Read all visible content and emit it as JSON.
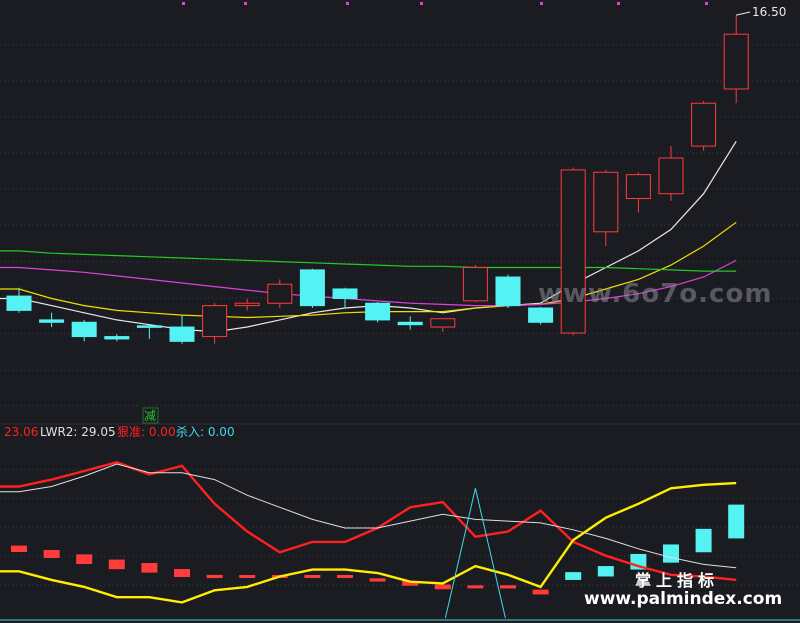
{
  "colors": {
    "background": "#1b1c21",
    "grid": "#3a3b46",
    "up": "#ff3b3b",
    "down": "#54f2f2",
    "ma_white": "#e8e8e8",
    "ma_yellow": "#f0e000",
    "ma_magenta": "#e040e0",
    "ma_green": "#22cc22",
    "ind_red": "#ff2020",
    "ind_yellow": "#ffee00",
    "ind_white": "#e0e0e0",
    "ind_cyan": "#3fd8e8"
  },
  "chart_data": [
    {
      "type": "candlestick",
      "ylim": [
        0,
        16.8
      ],
      "max_label": "16.50",
      "marker_text": "减",
      "candles": [
        {
          "o": 4.7,
          "h": 5.05,
          "l": 4.0,
          "c": 4.1
        },
        {
          "o": 3.7,
          "h": 4.0,
          "l": 3.4,
          "c": 3.6
        },
        {
          "o": 3.6,
          "h": 3.7,
          "l": 2.8,
          "c": 3.0
        },
        {
          "o": 3.0,
          "h": 3.1,
          "l": 2.8,
          "c": 2.9
        },
        {
          "o": 3.45,
          "h": 3.5,
          "l": 2.9,
          "c": 3.4
        },
        {
          "o": 3.4,
          "h": 3.9,
          "l": 2.7,
          "c": 2.8
        },
        {
          "o": 3.0,
          "h": 4.4,
          "l": 2.7,
          "c": 4.3
        },
        {
          "o": 4.3,
          "h": 4.6,
          "l": 4.1,
          "c": 4.4
        },
        {
          "o": 4.4,
          "h": 5.4,
          "l": 4.2,
          "c": 5.2
        },
        {
          "o": 5.8,
          "h": 5.85,
          "l": 4.2,
          "c": 4.3
        },
        {
          "o": 5.0,
          "h": 5.05,
          "l": 4.2,
          "c": 4.6
        },
        {
          "o": 4.4,
          "h": 4.45,
          "l": 3.6,
          "c": 3.7
        },
        {
          "o": 3.6,
          "h": 3.85,
          "l": 3.3,
          "c": 3.5
        },
        {
          "o": 3.4,
          "h": 3.5,
          "l": 3.2,
          "c": 3.75
        },
        {
          "o": 4.5,
          "h": 6.0,
          "l": 4.45,
          "c": 5.9
        },
        {
          "o": 5.5,
          "h": 5.6,
          "l": 4.2,
          "c": 4.3
        },
        {
          "o": 4.2,
          "h": 4.25,
          "l": 3.5,
          "c": 3.6
        },
        {
          "o": 3.15,
          "h": 10.1,
          "l": 3.05,
          "c": 10.0
        },
        {
          "o": 7.4,
          "h": 10.0,
          "l": 6.8,
          "c": 9.9
        },
        {
          "o": 8.8,
          "h": 9.9,
          "l": 8.2,
          "c": 9.8
        },
        {
          "o": 9.0,
          "h": 11.0,
          "l": 8.7,
          "c": 10.5
        },
        {
          "o": 11.0,
          "h": 12.9,
          "l": 10.8,
          "c": 12.8
        },
        {
          "o": 13.4,
          "h": 16.5,
          "l": 12.8,
          "c": 15.7
        }
      ],
      "ma": [
        {
          "color": "ma_white",
          "values": [
            4.6,
            4.3,
            4.0,
            3.7,
            3.5,
            3.3,
            3.2,
            3.4,
            3.7,
            4.0,
            4.2,
            4.3,
            4.2,
            4.0,
            4.2,
            4.3,
            4.4,
            5.2,
            5.9,
            6.6,
            7.5,
            9.0,
            11.2
          ]
        },
        {
          "color": "ma_yellow",
          "values": [
            5.0,
            4.6,
            4.3,
            4.1,
            4.0,
            3.9,
            3.85,
            3.8,
            3.85,
            3.9,
            4.0,
            4.05,
            4.05,
            4.05,
            4.2,
            4.3,
            4.35,
            4.6,
            5.0,
            5.4,
            6.0,
            6.8,
            7.8
          ]
        },
        {
          "color": "ma_magenta",
          "values": [
            5.9,
            5.8,
            5.7,
            5.55,
            5.4,
            5.25,
            5.1,
            4.95,
            4.8,
            4.7,
            4.6,
            4.5,
            4.4,
            4.35,
            4.3,
            4.3,
            4.35,
            4.45,
            4.6,
            4.8,
            5.1,
            5.5,
            6.2
          ]
        },
        {
          "color": "ma_green",
          "values": [
            6.6,
            6.5,
            6.45,
            6.4,
            6.35,
            6.3,
            6.25,
            6.2,
            6.15,
            6.1,
            6.05,
            6.0,
            5.95,
            5.95,
            5.9,
            5.9,
            5.9,
            5.9,
            5.9,
            5.85,
            5.8,
            5.75,
            5.75
          ]
        }
      ]
    },
    {
      "type": "line",
      "ylim": [
        0,
        100
      ],
      "legend": [
        {
          "text": "23.06",
          "color": "ind_red"
        },
        {
          "text": "LWR2: 29.05",
          "color": "ind_white"
        },
        {
          "text": "狠准: 0.00",
          "color": "ind_red"
        },
        {
          "text": "杀入: 0.00",
          "color": "ind_cyan"
        }
      ],
      "series": [
        {
          "color": "ind_red",
          "values": [
            76,
            80,
            85,
            90,
            83,
            88,
            66,
            50,
            38,
            44,
            44,
            52,
            64,
            67,
            47,
            50,
            62,
            44,
            36,
            30,
            25,
            24,
            22
          ]
        },
        {
          "color": "ind_white",
          "values": [
            73,
            76,
            82,
            89,
            84,
            84,
            80,
            71,
            64,
            57,
            52,
            52,
            56,
            60,
            57,
            56,
            55,
            51,
            46,
            40,
            35,
            31,
            29
          ]
        },
        {
          "color": "ind_yellow",
          "values": [
            27,
            22,
            18,
            12,
            12,
            9,
            16,
            18,
            24,
            28,
            28,
            26,
            21,
            20,
            30,
            25,
            18,
            45,
            58,
            66,
            75,
            77,
            78
          ]
        }
      ],
      "spike": {
        "index": 14,
        "value": 75
      },
      "bars": [
        {
          "dir": "down",
          "v": 40
        },
        {
          "dir": "down",
          "v": 37
        },
        {
          "dir": "down",
          "v": 34
        },
        {
          "dir": "down",
          "v": 31
        },
        {
          "dir": "down",
          "v": 29
        },
        {
          "dir": "down",
          "v": 26
        },
        {
          "dir": "down",
          "v": 24
        },
        {
          "dir": "down",
          "v": 24
        },
        {
          "dir": "down",
          "v": 24
        },
        {
          "dir": "down",
          "v": 24
        },
        {
          "dir": "down",
          "v": 24
        },
        {
          "dir": "down",
          "v": 22
        },
        {
          "dir": "down",
          "v": 20
        },
        {
          "dir": "down",
          "v": 18
        },
        {
          "dir": "down",
          "v": 18
        },
        {
          "dir": "down",
          "v": 18
        },
        {
          "dir": "down",
          "v": 15
        },
        {
          "dir": "up",
          "v": 22
        },
        {
          "dir": "up",
          "v": 24
        },
        {
          "dir": "up",
          "v": 28
        },
        {
          "dir": "up",
          "v": 32
        },
        {
          "dir": "up",
          "v": 38
        },
        {
          "dir": "up",
          "v": 46
        }
      ],
      "bar_lengths": [
        4,
        5,
        6,
        6,
        6,
        5,
        2,
        1,
        1,
        1,
        1,
        2,
        3,
        3,
        1,
        2,
        3,
        3,
        4,
        6,
        7,
        9,
        13
      ]
    }
  ],
  "watermarks": {
    "site_large": "www.6o7o.com",
    "brand_cn": "掌上指标",
    "site_small": "www.palmindex.com"
  }
}
